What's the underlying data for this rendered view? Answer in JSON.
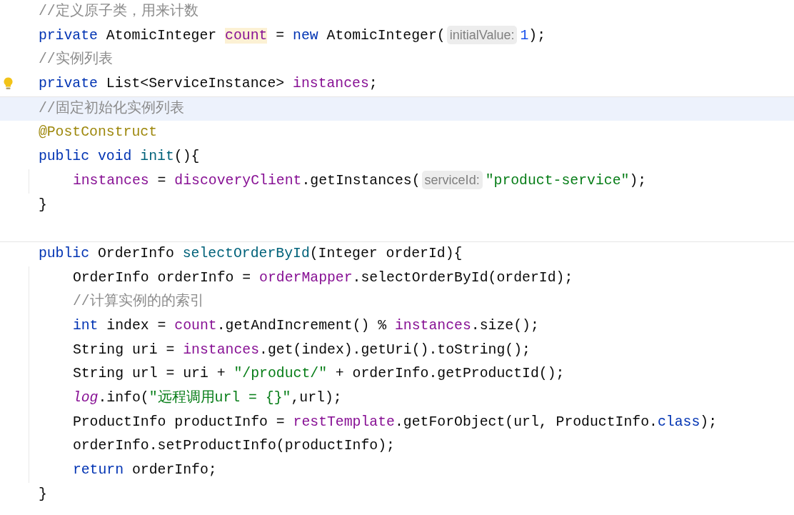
{
  "sections": [
    {
      "lines": [
        {
          "current": false,
          "bulb": false,
          "tokens": [
            {
              "kind": "comment",
              "text": "//定义原子类，用来计数"
            }
          ]
        },
        {
          "current": false,
          "bulb": false,
          "tokens": [
            {
              "kind": "keyword",
              "text": "private"
            },
            {
              "kind": "plain",
              "text": " AtomicInteger "
            },
            {
              "kind": "usage",
              "text": "count"
            },
            {
              "kind": "plain",
              "text": " = "
            },
            {
              "kind": "keyword",
              "text": "new"
            },
            {
              "kind": "plain",
              "text": " AtomicInteger("
            },
            {
              "kind": "hint",
              "text": "initialValue:"
            },
            {
              "kind": "number",
              "text": "1"
            },
            {
              "kind": "plain",
              "text": ");"
            }
          ]
        },
        {
          "current": false,
          "bulb": false,
          "tokens": [
            {
              "kind": "comment",
              "text": "//实例列表"
            }
          ]
        },
        {
          "current": false,
          "bulb": true,
          "tokens": [
            {
              "kind": "keyword",
              "text": "private"
            },
            {
              "kind": "plain",
              "text": " List<ServiceInstance> "
            },
            {
              "kind": "field",
              "text": "instances"
            },
            {
              "kind": "plain",
              "text": ";"
            }
          ]
        }
      ]
    },
    {
      "lines": [
        {
          "current": true,
          "bulb": false,
          "tokens": [
            {
              "kind": "comment",
              "text": "//固定初始化实例列表"
            }
          ]
        },
        {
          "current": false,
          "bulb": false,
          "tokens": [
            {
              "kind": "annotation",
              "text": "@PostConstruct"
            }
          ]
        },
        {
          "current": false,
          "bulb": false,
          "tokens": [
            {
              "kind": "keyword",
              "text": "public void "
            },
            {
              "kind": "method",
              "text": "init"
            },
            {
              "kind": "plain",
              "text": "(){"
            }
          ],
          "children": [
            {
              "current": false,
              "bulb": false,
              "tokens": [
                {
                  "kind": "field",
                  "text": "instances"
                },
                {
                  "kind": "plain",
                  "text": " = "
                },
                {
                  "kind": "field",
                  "text": "discoveryClient"
                },
                {
                  "kind": "plain",
                  "text": ".getInstances("
                },
                {
                  "kind": "hint",
                  "text": "serviceId:"
                },
                {
                  "kind": "string",
                  "text": "\"product-service\""
                },
                {
                  "kind": "plain",
                  "text": ");"
                }
              ]
            }
          ]
        },
        {
          "current": false,
          "bulb": false,
          "tokens": [
            {
              "kind": "plain",
              "text": "}"
            }
          ]
        },
        {
          "current": false,
          "bulb": false
        }
      ]
    },
    {
      "lines": [
        {
          "current": false,
          "bulb": false,
          "tokens": [
            {
              "kind": "keyword",
              "text": "public"
            },
            {
              "kind": "plain",
              "text": " OrderInfo "
            },
            {
              "kind": "method",
              "text": "selectOrderById"
            },
            {
              "kind": "plain",
              "text": "(Integer orderId){"
            }
          ],
          "children": [
            {
              "current": false,
              "bulb": false,
              "tokens": [
                {
                  "kind": "plain",
                  "text": "OrderInfo orderInfo = "
                },
                {
                  "kind": "field",
                  "text": "orderMapper"
                },
                {
                  "kind": "plain",
                  "text": ".selectOrderById(orderId);"
                }
              ]
            },
            {
              "current": false,
              "bulb": false,
              "tokens": [
                {
                  "kind": "comment",
                  "text": "//计算实例的的索引"
                }
              ]
            },
            {
              "current": false,
              "bulb": false,
              "tokens": [
                {
                  "kind": "keyword",
                  "text": "int"
                },
                {
                  "kind": "plain",
                  "text": " index = "
                },
                {
                  "kind": "field",
                  "text": "count"
                },
                {
                  "kind": "plain",
                  "text": ".getAndIncrement() % "
                },
                {
                  "kind": "field",
                  "text": "instances"
                },
                {
                  "kind": "plain",
                  "text": ".size();"
                }
              ]
            },
            {
              "current": false,
              "bulb": false,
              "tokens": [
                {
                  "kind": "plain",
                  "text": "String uri = "
                },
                {
                  "kind": "field",
                  "text": "instances"
                },
                {
                  "kind": "plain",
                  "text": ".get(index).getUri().toString();"
                }
              ]
            },
            {
              "current": false,
              "bulb": false,
              "tokens": [
                {
                  "kind": "plain",
                  "text": "String url = uri + "
                },
                {
                  "kind": "string",
                  "text": "\"/product/\""
                },
                {
                  "kind": "plain",
                  "text": " + orderInfo.getProductId();"
                }
              ]
            },
            {
              "current": false,
              "bulb": false,
              "tokens": [
                {
                  "kind": "static",
                  "text": "log"
                },
                {
                  "kind": "plain",
                  "text": ".info("
                },
                {
                  "kind": "string",
                  "text": "\"远程调用url = {}\""
                },
                {
                  "kind": "plain",
                  "text": ",url);"
                }
              ]
            },
            {
              "current": false,
              "bulb": false,
              "tokens": [
                {
                  "kind": "plain",
                  "text": "ProductInfo productInfo = "
                },
                {
                  "kind": "field",
                  "text": "restTemplate"
                },
                {
                  "kind": "plain",
                  "text": ".getForObject(url, ProductInfo."
                },
                {
                  "kind": "keyword",
                  "text": "class"
                },
                {
                  "kind": "plain",
                  "text": ");"
                }
              ]
            },
            {
              "current": false,
              "bulb": false,
              "tokens": [
                {
                  "kind": "plain",
                  "text": "orderInfo.setProductInfo(productInfo);"
                }
              ]
            },
            {
              "current": false,
              "bulb": false,
              "tokens": [
                {
                  "kind": "keyword",
                  "text": "return"
                },
                {
                  "kind": "plain",
                  "text": " orderInfo;"
                }
              ]
            }
          ]
        },
        {
          "current": false,
          "bulb": false,
          "tokens": [
            {
              "kind": "plain",
              "text": "}"
            }
          ]
        }
      ]
    }
  ]
}
